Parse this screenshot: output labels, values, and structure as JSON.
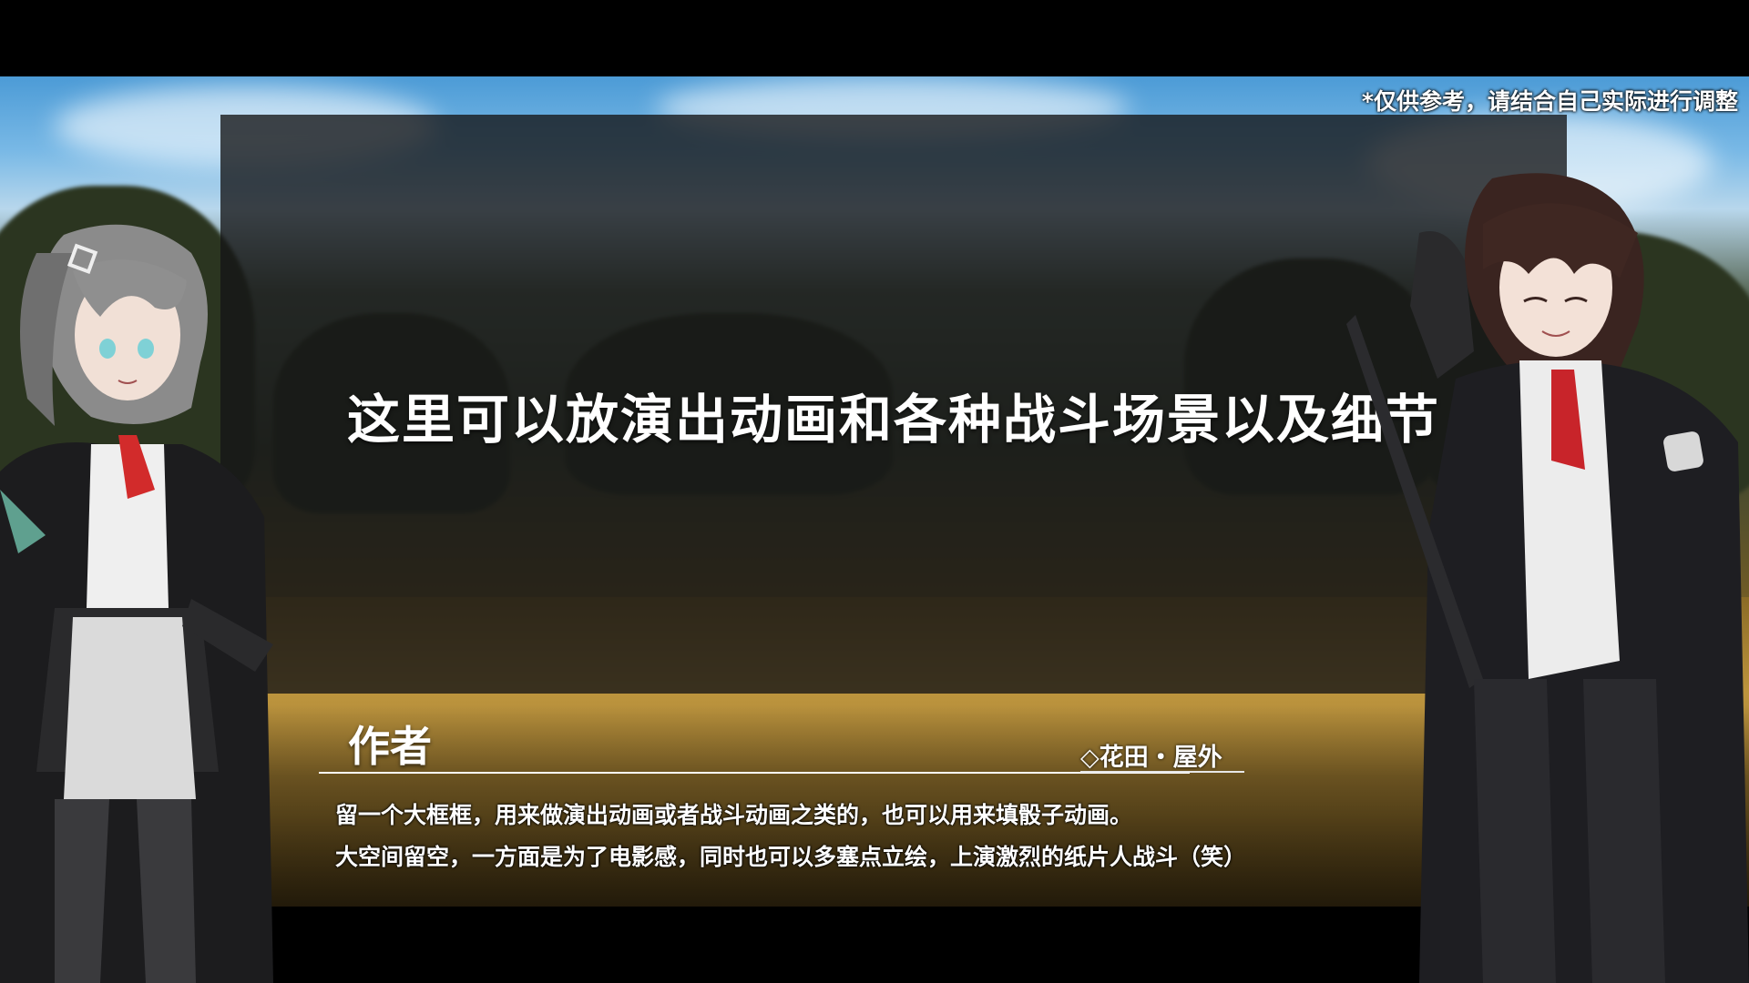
{
  "scene": {
    "note": "*仅供参考，请结合自己实际进行调整",
    "panel_caption": "这里可以放演出动画和各种战斗场景以及细节",
    "location": "◇花田・屋外"
  },
  "dialog": {
    "speaker": "作者",
    "lines": [
      "留一个大框框，用来做演出动画或者战斗动画之类的，也可以用来填骰子动画。",
      "大空间留空，一方面是为了电影感，同时也可以多塞点立绘，上演激烈的纸片人战斗（笑）"
    ]
  },
  "characters": {
    "left": "grey-haired-girl-sprite",
    "right": "brown-haired-boy-sprite"
  }
}
